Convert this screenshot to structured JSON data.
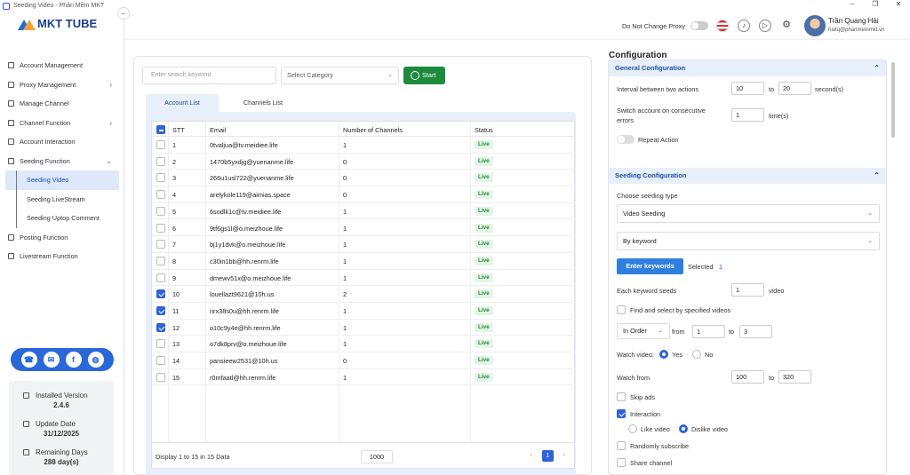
{
  "window": {
    "title": "Seeding Video - Phần Mềm MKT",
    "controls": [
      "–",
      "❐",
      "✕"
    ]
  },
  "logo": {
    "text": "MKT TUBE"
  },
  "sidebar": {
    "items": [
      {
        "label": "Account Management"
      },
      {
        "label": "Proxy Management"
      },
      {
        "label": "Manage Channel"
      },
      {
        "label": "Channel Function"
      },
      {
        "label": "Account Interaction"
      },
      {
        "label": "Seeding Function"
      },
      {
        "label": "Posting Function"
      },
      {
        "label": "Livestream Function"
      }
    ],
    "sub_items": [
      {
        "label": "Seeding Video"
      },
      {
        "label": "Seeding LiveStream"
      },
      {
        "label": "Seeding Uptop Comment"
      }
    ],
    "social_icons": [
      "support-icon",
      "messenger-icon",
      "facebook-icon",
      "globe-icon"
    ],
    "info": {
      "version_label": "Installed Version",
      "version": "2.4.6",
      "update_label": "Update Date",
      "update": "31/12/2025",
      "remaining_label": "Remaining Days",
      "remaining": "288 day(s)"
    }
  },
  "topbar": {
    "proxy_label": "Do Not Change Proxy",
    "user_name": "Trần Quang Hải",
    "user_email": "haitq@phanmemmkt.vn"
  },
  "main": {
    "search_placeholder": "Enter search keyword",
    "category": "Select Category",
    "start": "Start",
    "tabs": [
      "Account List",
      "Channels List"
    ],
    "columns": [
      "STT",
      "Email",
      "Number of Channels",
      "Status"
    ],
    "rows": [
      {
        "stt": "1",
        "email": "0tvaljua@tv.meidiee.life",
        "channels": "1",
        "status": "Live",
        "checked": false
      },
      {
        "stt": "2",
        "email": "1470b5yxdjg@yuenanme.life",
        "channels": "0",
        "status": "Live",
        "checked": false
      },
      {
        "stt": "3",
        "email": "266u1usl722@yuenanme.life",
        "channels": "0",
        "status": "Live",
        "checked": false
      },
      {
        "stt": "4",
        "email": "arelykole119@aimias.space",
        "channels": "0",
        "status": "Live",
        "checked": false
      },
      {
        "stt": "5",
        "email": "6sodlk1c@tv.meidiee.life",
        "channels": "1",
        "status": "Live",
        "checked": false
      },
      {
        "stt": "6",
        "email": "9tf6gs1l@o.meizhoue.life",
        "channels": "1",
        "status": "Live",
        "checked": false
      },
      {
        "stt": "7",
        "email": "bj1y1dvk@o.meizhoue.life",
        "channels": "1",
        "status": "Live",
        "checked": false
      },
      {
        "stt": "8",
        "email": "c30in1bb@hh.renrm.life",
        "channels": "1",
        "status": "Live",
        "checked": false
      },
      {
        "stt": "9",
        "email": "dmewv51x@o.meizhoue.life",
        "channels": "1",
        "status": "Live",
        "checked": false
      },
      {
        "stt": "10",
        "email": "louellazt9621@10h.us",
        "channels": "2",
        "status": "Live",
        "checked": true
      },
      {
        "stt": "11",
        "email": "nrx38s0u@hh.renrm.life",
        "channels": "1",
        "status": "Live",
        "checked": true
      },
      {
        "stt": "12",
        "email": "o10c9y4e@hh.renrm.life",
        "channels": "1",
        "status": "Live",
        "checked": true
      },
      {
        "stt": "13",
        "email": "o7dk8prv@o.meizhoue.life",
        "channels": "1",
        "status": "Live",
        "checked": false
      },
      {
        "stt": "14",
        "email": "pansieew2531@10h.us",
        "channels": "0",
        "status": "Live",
        "checked": false
      },
      {
        "stt": "15",
        "email": "r0mfaatl@hh.renrm.life",
        "channels": "1",
        "status": "Live",
        "checked": false
      }
    ],
    "display_text": "Display 1 to 15 in 15 Data",
    "page_size": "1000",
    "current_page": "1",
    "prev": "‹",
    "next": "›"
  },
  "config": {
    "title": "Configuration",
    "general_header": "General Configuration",
    "interval_label": "Interval between two actions",
    "interval_from": "10",
    "interval_to_label": "to",
    "interval_to": "20",
    "interval_unit": "second(s)",
    "switch_label_1": "Switch account on consecutive",
    "switch_label_2": "errors",
    "switch_value": "1",
    "switch_unit": "time(s)",
    "repeat_label": "Repeat Action",
    "seeding_header": "Seeding Configuration",
    "choose_type_label": "Choose seeding type",
    "seeding_type": "Video Seeding",
    "seed_by": "By keyword",
    "enter_keywords": "Enter keywords",
    "selected_label": "Selected",
    "selected_count": "1",
    "each_keyword_label": "Each keyword seeds",
    "each_keyword_value": "1",
    "each_keyword_unit": "video",
    "find_select_label": "Find and select by specified videos",
    "order": "In Order",
    "from_label": "from",
    "from_value": "1",
    "to_label": "to",
    "to_value": "3",
    "watch_video_label": "Watch video:",
    "yes": "Yes",
    "no": "No",
    "watch_from_label": "Watch from",
    "watch_from": "100",
    "watch_to_label": "to",
    "watch_to": "320",
    "skip_ads": "Skip ads",
    "interaction": "Interaction",
    "like_video": "Like video",
    "dislike_video": "Dislike video",
    "random_subscribe": "Randomly subscribe",
    "share_channel": "Share channel"
  }
}
